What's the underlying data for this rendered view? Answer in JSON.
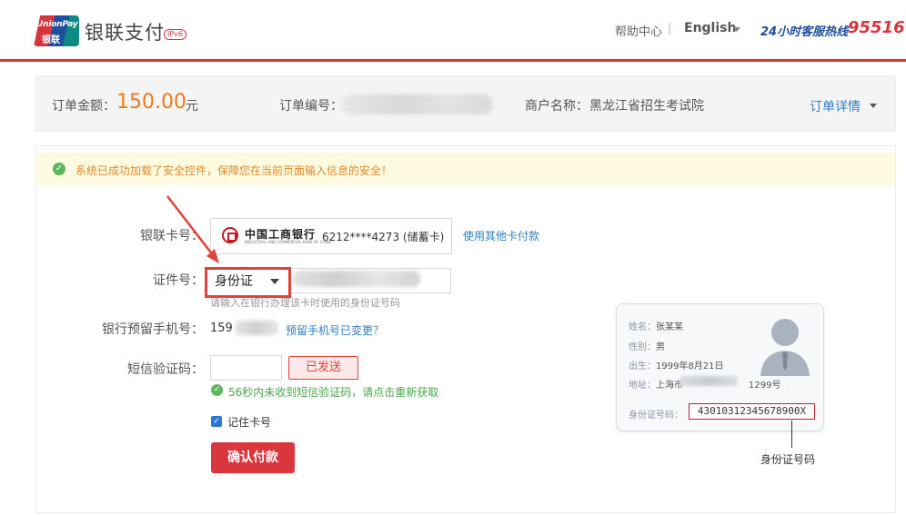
{
  "header": {
    "logo_text_top": "UnionPay",
    "logo_text_bottom": "银联",
    "brand_title": "银联支付",
    "ipv6_badge": "IPv6",
    "help_center": "帮助中心",
    "separator": "|",
    "language": "English",
    "hotline_label": "24小时客服热线",
    "hotline_number": "95516"
  },
  "order": {
    "amount_label": "订单金额：",
    "amount": "150.00",
    "amount_unit": "元",
    "number_label": "订单编号：",
    "merchant_label": "商户名称：",
    "merchant_name": "黑龙江省招生考试院",
    "details_link": "订单详情"
  },
  "notice": {
    "icon": "check-circle-icon",
    "text": "系统已成功加载了安全控件，保障您在当前页面输入信息的安全！"
  },
  "form": {
    "card_label": "银联卡号：",
    "bank_name": "中国工商银行",
    "bank_name_en": "INDUSTRIAL AND COMMERCIAL BANK OF CHINA",
    "card_number": "6212****4273 (储蓄卡)",
    "other_card_link": "使用其他卡付款",
    "id_label": "证件号：",
    "id_type": "身份证",
    "id_hint": "请输入在银行办理该卡时使用的身份证号码",
    "phone_label": "银行预留手机号：",
    "phone_prefix": "159",
    "phone_change_link": "预留手机号已变更？",
    "sms_label": "短信验证码：",
    "sms_button": "已发送",
    "sms_status": "56秒内未收到短信验证码，请点击重新获取",
    "remember_label": "记住卡号",
    "confirm_button": "确认付款"
  },
  "id_card_sample": {
    "name_key": "姓名：",
    "name_val": "张某某",
    "gender_key": "性别：",
    "gender_val": "男",
    "birth_key": "出生：",
    "birth_val": "1999年8月21日",
    "addr_key": "地址：",
    "addr_prefix": "上海市",
    "addr_suffix": "1299号",
    "num_key": "身份证号码：",
    "num_val": "43010312345678900X",
    "caption": "身份证号码"
  },
  "colors": {
    "brand_red": "#d7353e",
    "brand_blue": "#1f4f9c",
    "amount_orange": "#f07a1a",
    "link_blue": "#2f7fc5",
    "annotation_red": "#e0433a"
  }
}
